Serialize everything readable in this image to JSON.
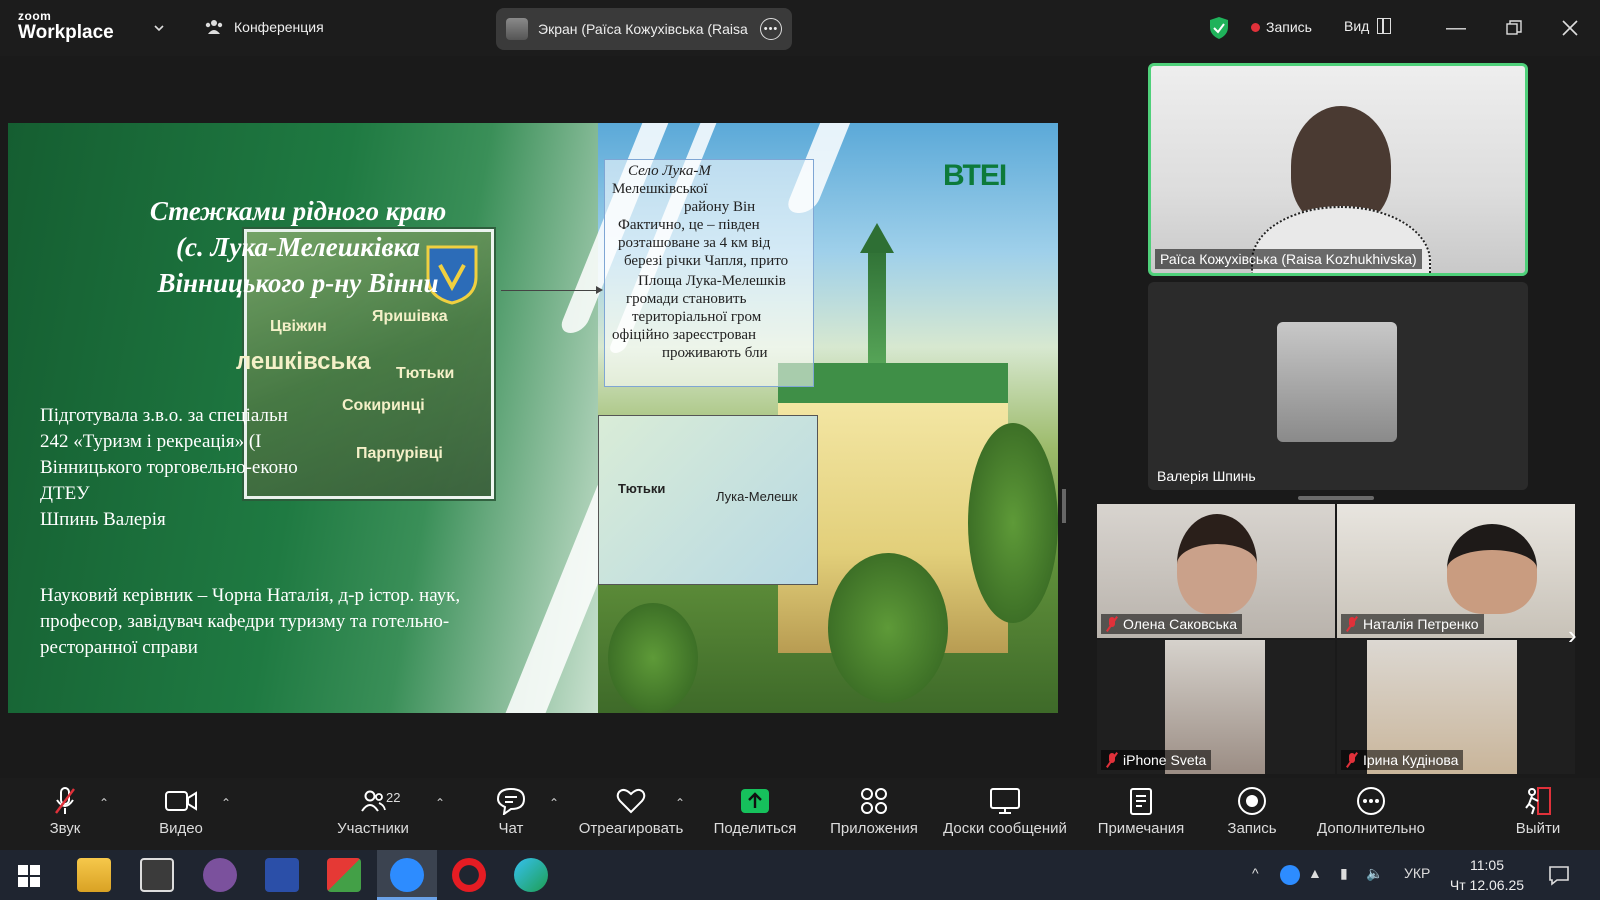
{
  "topbar": {
    "logo_line1": "zoom",
    "logo_line2": "Workplace",
    "meeting_label": "Конференция",
    "share_title": "Экран (Раїса Кожухівська (Raisa I",
    "recording_label": "Запись",
    "view_label": "Вид"
  },
  "slide": {
    "title_lines": [
      "Стежками рідного краю",
      "(с. Лука-Мелешківка",
      "Вінницького р-ну Вінни"
    ],
    "prepared_by": "Підготувала з.в.о. за спеціальн\n242 «Туризм і рекреація» (І\nВінницького торговельно-еконо\nДТЕУ\nШпинь Валерія",
    "supervisor": "Науковий керівник – Чорна Наталія, д-р істор. наук,\nпрофесор, завідувач кафедри туризму та готельно-\nресторанної справи",
    "textbox_lines": [
      "Село Лука-М",
      "Мелешківської",
      "району Він",
      "Фактично, це – півден",
      "розташоване за 4 км від",
      "березі річки Чапля, прито",
      "Площа Лука-Мелешків",
      "громади становить",
      "територіальної гром",
      "офіційно зареєстрован",
      "проживають бли"
    ],
    "map_labels": [
      "Тютьки",
      "Лука-Мелешк"
    ],
    "aerial_labels": [
      "Цвіжин",
      "Яришівка",
      "лешківська",
      "Тютьки",
      "Сокиринці",
      "Парпурівці"
    ],
    "logo_text": "ВТЕІ"
  },
  "participants": {
    "speaker_name": "Раїса Кожухівська (Raisa Kozhukhivska)",
    "second_name": "Валерія Шпинь",
    "grid": [
      {
        "name": "Олена Саковська",
        "muted": true
      },
      {
        "name": "Наталія Петренко",
        "muted": true
      },
      {
        "name": "iPhone Sveta",
        "muted": true
      },
      {
        "name": "Ірина  Кудінова",
        "muted": true
      }
    ]
  },
  "toolbar": {
    "audio": "Звук",
    "video": "Видео",
    "participants": "Участники",
    "participants_count": "22",
    "chat": "Чат",
    "react": "Отреагировать",
    "share": "Поделиться",
    "apps": "Приложения",
    "whiteboards": "Доски сообщений",
    "notes": "Примечания",
    "record": "Запись",
    "more": "Дополнительно",
    "leave": "Выйти"
  },
  "taskbar": {
    "language": "УКР",
    "time": "11:05",
    "date": "Чт 12.06.25"
  },
  "colors": {
    "accent_green": "#4fd07a",
    "record_red": "#e0313a",
    "share_green": "#16c15c"
  }
}
